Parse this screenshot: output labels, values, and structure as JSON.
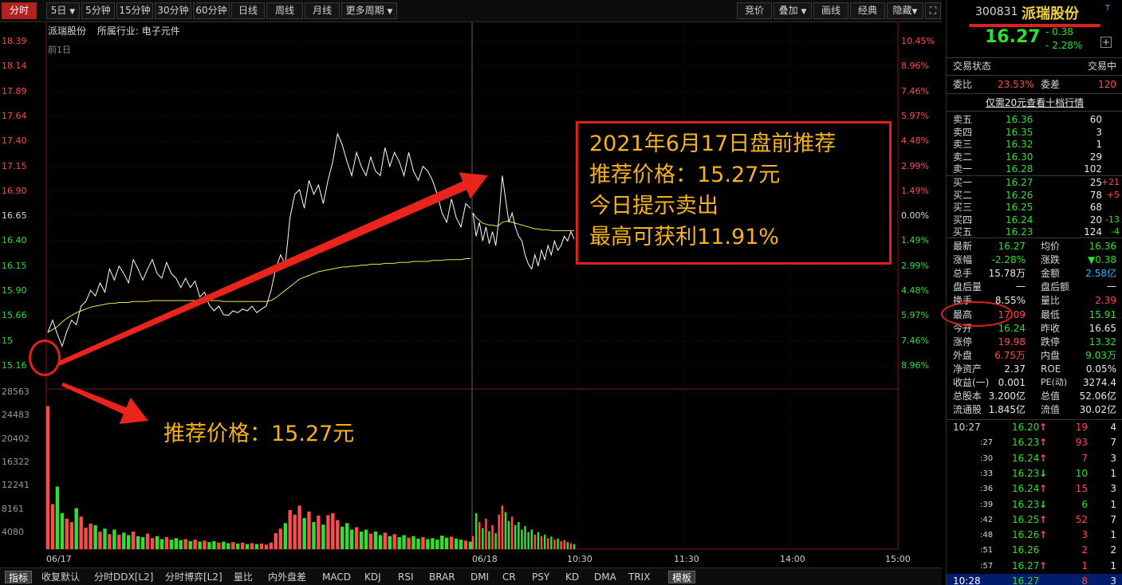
{
  "toolbar": {
    "tabs": [
      "分时",
      "5日",
      "5分钟",
      "15分钟",
      "30分钟",
      "60分钟",
      "日线",
      "周线",
      "月线",
      "更多周期"
    ],
    "right_buttons": [
      "竞价",
      "叠加",
      "画线",
      "经典",
      "隐藏"
    ]
  },
  "stock_info": {
    "name": "派瑞股份",
    "industry": "所属行业: 电子元件",
    "prev_day_label": "前1日"
  },
  "price_axis": {
    "prices": [
      "18.39",
      "18.14",
      "17.89",
      "17.64",
      "17.40",
      "17.15",
      "16.90",
      "16.65",
      "16.40",
      "16.15",
      "15.90",
      "15.66",
      "15",
      "15.16"
    ],
    "percents": [
      "10.45%",
      "8.96%",
      "7.46%",
      "5.97%",
      "4.48%",
      "2.99%",
      "1.49%",
      "0.00%",
      "1.49%",
      "2.99%",
      "4.48%",
      "5.97%",
      "7.46%",
      "8.96%"
    ]
  },
  "volume_axis": {
    "labels": [
      "28563",
      "24483",
      "20402",
      "16322",
      "12241",
      "8161",
      "4080"
    ]
  },
  "time_axis": {
    "labels": [
      "06/17",
      "06/18",
      "10:30",
      "11:30",
      "14:00",
      "15:00"
    ]
  },
  "chart_data": {
    "type": "line",
    "title": "",
    "xlabel": "",
    "ylabel": "",
    "prev_close": 16.65,
    "ylim": [
      14.91,
      18.39
    ],
    "volume_ylim": [
      0,
      32643
    ],
    "days": [
      {
        "date": "06/17",
        "price": [
          15.27,
          15.4,
          15.25,
          15.12,
          15.28,
          15.4,
          15.35,
          15.55,
          15.6,
          15.72,
          15.66,
          15.8,
          15.7,
          15.95,
          15.83,
          15.98,
          15.9,
          15.8,
          16.05,
          15.95,
          15.83,
          15.95,
          16.05,
          15.9,
          15.85,
          16.02,
          15.9,
          15.85,
          15.75,
          15.85,
          15.75,
          15.82,
          15.65,
          15.7,
          15.56,
          15.5,
          15.55,
          15.46,
          15.45,
          15.5,
          15.48,
          15.52,
          15.5,
          15.55,
          15.48,
          15.52,
          15.55,
          15.72,
          15.95,
          16.1,
          16.0,
          16.5,
          16.75,
          16.8,
          16.6,
          16.9,
          16.75,
          16.85,
          16.65,
          16.9,
          17.1,
          17.4,
          17.28,
          17.1,
          16.95,
          17.2,
          17.05,
          16.95,
          17.15,
          17.0,
          16.95,
          17.25,
          17.05,
          17.2,
          17.1,
          16.95,
          17.2,
          17.0,
          16.9,
          17.05,
          17.0,
          16.9,
          16.75,
          16.55,
          16.45,
          16.7,
          16.5,
          16.4,
          16.65,
          16.6
        ],
        "avg": [
          15.27,
          15.3,
          15.33,
          15.38,
          15.42,
          15.45,
          15.48,
          15.5,
          15.52,
          15.54,
          15.55,
          15.56,
          15.57,
          15.58,
          15.58,
          15.59,
          15.59,
          15.59,
          15.6,
          15.6,
          15.6,
          15.6,
          15.61,
          15.61,
          15.61,
          15.61,
          15.61,
          15.61,
          15.61,
          15.61,
          15.61,
          15.61,
          15.61,
          15.61,
          15.61,
          15.61,
          15.61,
          15.6,
          15.6,
          15.6,
          15.6,
          15.6,
          15.6,
          15.6,
          15.6,
          15.6,
          15.6,
          15.61,
          15.64,
          15.68,
          15.72,
          15.76,
          15.8,
          15.84,
          15.86,
          15.88,
          15.9,
          15.92,
          15.93,
          15.94,
          15.95,
          15.96,
          15.97,
          15.97,
          15.98,
          15.98,
          15.99,
          15.99,
          16.0,
          16.0,
          16.0,
          16.01,
          16.01,
          16.01,
          16.02,
          16.02,
          16.02,
          16.03,
          16.03,
          16.03,
          16.03,
          16.04,
          16.04,
          16.04,
          16.05,
          16.05,
          16.05,
          16.05,
          16.06,
          16.06
        ],
        "volume": [
          28563,
          9000,
          12500,
          7200,
          6100,
          5400,
          8200,
          6500,
          4300,
          5100,
          4800,
          3500,
          4100,
          3000,
          3900,
          2900,
          3300,
          2800,
          3500,
          2600,
          2400,
          3100,
          2200,
          2600,
          2000,
          2400,
          1900,
          2200,
          1800,
          2000,
          1600,
          1900,
          1500,
          1700,
          1400,
          1600,
          1300,
          1500,
          1200,
          1400,
          1100,
          1300,
          1000,
          1200,
          1000,
          1100,
          900,
          1300,
          3200,
          4100,
          5200,
          7800,
          6900,
          8700,
          6200,
          7500,
          5400,
          6700,
          4900,
          6800,
          7200,
          5800,
          4500,
          5200,
          3900,
          4400,
          3500,
          3900,
          3100,
          3500,
          2800,
          3300,
          2600,
          3000,
          2400,
          2800,
          2300,
          2600,
          2100,
          2400,
          2000,
          2200,
          1900,
          2700,
          2300,
          2500,
          2100,
          1900,
          1700,
          1500
        ]
      },
      {
        "date": "06/18",
        "price": [
          16.55,
          16.3,
          16.45,
          16.25,
          16.4,
          16.22,
          16.35,
          16.2,
          16.5,
          16.95,
          16.7,
          16.45,
          16.55,
          16.4,
          16.3,
          16.25,
          16.1,
          16.0,
          15.95,
          16.1,
          15.98,
          16.15,
          16.05,
          16.2,
          16.1,
          16.25,
          16.15,
          16.2,
          16.3,
          16.25,
          16.35,
          16.27
        ],
        "avg": [
          16.55,
          16.5,
          16.47,
          16.44,
          16.43,
          16.42,
          16.42,
          16.41,
          16.42,
          16.45,
          16.46,
          16.46,
          16.45,
          16.44,
          16.43,
          16.42,
          16.41,
          16.4,
          16.39,
          16.38,
          16.38,
          16.37,
          16.37,
          16.37,
          16.36,
          16.36,
          16.36,
          16.36,
          16.36,
          16.36,
          16.36,
          16.36
        ],
        "volume": [
          2600,
          7200,
          5400,
          4200,
          6100,
          3600,
          4800,
          3200,
          6900,
          8700,
          7400,
          5600,
          6500,
          4800,
          5400,
          3900,
          4600,
          3400,
          3900,
          2900,
          3400,
          2600,
          2900,
          2200,
          2500,
          1900,
          2100,
          1600,
          1800,
          1400,
          1200,
          1000
        ]
      }
    ]
  },
  "annotations": {
    "callout_lines": [
      "2021年6月17日盘前推荐",
      "推荐价格：15.27元",
      "今日提示卖出",
      "最高可获利11.91%"
    ],
    "arrow_text": "推荐价格：15.27元"
  },
  "bottom_tabs": [
    "指标",
    "收复默认",
    "分时DDX[L2]",
    "分时博弈[L2]",
    "量比",
    "内外盘差",
    "MACD",
    "KDJ",
    "RSI",
    "BRAR",
    "DMI",
    "CR",
    "PSY",
    "KD",
    "DMA",
    "TRIX",
    "模板"
  ],
  "quote_panel": {
    "code": "300831",
    "name": "派瑞股份",
    "flag": "T",
    "price": "16.27",
    "change": "- 0.38",
    "change_pct": "- 2.28%",
    "trade_status_label": "交易状态",
    "trade_status": "交易中",
    "wb_label": "委比",
    "wb_value": "23.53%",
    "wc_label": "委差",
    "wc_value": "120",
    "depth_link": "仅需20元查看十档行情",
    "asks": [
      {
        "label": "卖五",
        "price": "16.36",
        "vol": "60",
        "delta": ""
      },
      {
        "label": "卖四",
        "price": "16.35",
        "vol": "3",
        "delta": ""
      },
      {
        "label": "卖三",
        "price": "16.32",
        "vol": "1",
        "delta": ""
      },
      {
        "label": "卖二",
        "price": "16.30",
        "vol": "29",
        "delta": ""
      },
      {
        "label": "卖一",
        "price": "16.28",
        "vol": "102",
        "delta": ""
      }
    ],
    "bids": [
      {
        "label": "买一",
        "price": "16.27",
        "vol": "25",
        "delta": "+21"
      },
      {
        "label": "买二",
        "price": "16.26",
        "vol": "78",
        "delta": "+5"
      },
      {
        "label": "买三",
        "price": "16.25",
        "vol": "68",
        "delta": ""
      },
      {
        "label": "买四",
        "price": "16.24",
        "vol": "20",
        "delta": "-13"
      },
      {
        "label": "买五",
        "price": "16.23",
        "vol": "124",
        "delta": "-4"
      }
    ],
    "stats": [
      {
        "l1": "最新",
        "v1": "16.27",
        "l2": "均价",
        "v2": "16.36"
      },
      {
        "l1": "涨幅",
        "v1": "-2.28%",
        "l2": "涨跌",
        "v2": "▼0.38"
      },
      {
        "l1": "总手",
        "v1": "15.78万",
        "l2": "金额",
        "v2": "2.58亿"
      },
      {
        "l1": "盘后量",
        "v1": "一",
        "l2": "盘后额",
        "v2": "一"
      },
      {
        "l1": "换手",
        "v1": "8.55%",
        "l2": "量比",
        "v2": "2.39"
      },
      {
        "l1": "最高",
        "v1": "17.09",
        "l2": "最低",
        "v2": "15.91"
      },
      {
        "l1": "今开",
        "v1": "16.24",
        "l2": "昨收",
        "v2": "16.65"
      },
      {
        "l1": "涨停",
        "v1": "19.98",
        "l2": "跌停",
        "v2": "13.32"
      },
      {
        "l1": "外盘",
        "v1": "6.75万",
        "l2": "内盘",
        "v2": "9.03万"
      },
      {
        "l1": "净资产",
        "v1": "2.37",
        "l2": "ROE",
        "v2": "0.05%"
      },
      {
        "l1": "收益(一)",
        "v1": "0.001",
        "l2": "PE(动)",
        "v2": "3274.4"
      },
      {
        "l1": "总股本",
        "v1": "3.200亿",
        "l2": "总值",
        "v2": "52.06亿"
      },
      {
        "l1": "流通股",
        "v1": "1.845亿",
        "l2": "流值",
        "v2": "30.02亿"
      }
    ],
    "ticks": [
      {
        "time": "10:27",
        "price": "16.20",
        "dir": "↑",
        "vol": "19",
        "n": "4"
      },
      {
        "time": ":27",
        "price": "16.23",
        "dir": "↑",
        "vol": "93",
        "n": "7"
      },
      {
        "time": ":30",
        "price": "16.24",
        "dir": "↑",
        "vol": "7",
        "n": "3"
      },
      {
        "time": ":33",
        "price": "16.23",
        "dir": "↓",
        "vol": "10",
        "n": "1"
      },
      {
        "time": ":36",
        "price": "16.24",
        "dir": "↑",
        "vol": "15",
        "n": "3"
      },
      {
        "time": ":39",
        "price": "16.23",
        "dir": "↓",
        "vol": "6",
        "n": "1"
      },
      {
        "time": ":42",
        "price": "16.25",
        "dir": "↑",
        "vol": "52",
        "n": "7"
      },
      {
        "time": ":48",
        "price": "16.26",
        "dir": "↑",
        "vol": "3",
        "n": "1"
      },
      {
        "time": ":51",
        "price": "16.26",
        "dir": "",
        "vol": "2",
        "n": "2"
      },
      {
        "time": ":57",
        "price": "16.27",
        "dir": "↑",
        "vol": "1",
        "n": "1"
      },
      {
        "time": "10:28",
        "price": "16.27",
        "dir": "",
        "vol": "8",
        "n": "3"
      }
    ]
  },
  "colors": {
    "up": "#ff4b4b",
    "down": "#2fe02f",
    "avg_line": "#e8e84a",
    "price_line": "#ffffff",
    "accent": "#e0201c",
    "callout_text": "#f5b21a"
  }
}
